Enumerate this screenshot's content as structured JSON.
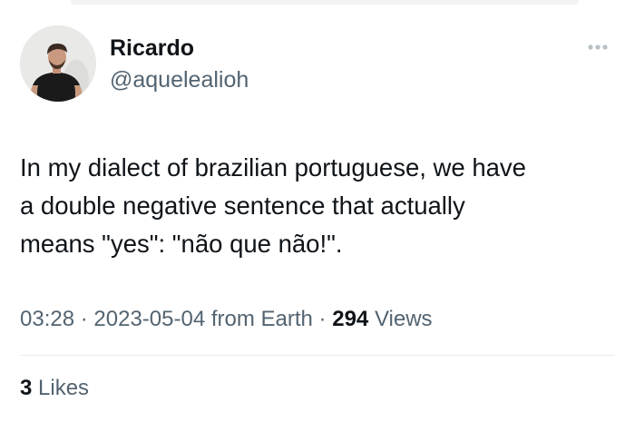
{
  "tweet": {
    "author_name": "Ricardo",
    "author_handle": "@aquelealioh",
    "text": "In my dialect of brazilian portuguese, we have\na double negative sentence that actually\nmeans \"yes\": \"não que não!\".",
    "time": "03:28",
    "separator": "·",
    "date": "2023-05-04",
    "source": "from Earth",
    "views_count": "294",
    "views_label": "Views",
    "likes_count": "3",
    "likes_label": "Likes"
  },
  "icons": {
    "more": "more-horizontal-icon",
    "avatar": "profile-photo"
  },
  "colors": {
    "text_primary": "#0f1419",
    "text_secondary": "#536471",
    "divider": "#e7e9ea",
    "more_icon": "#b9c0c6"
  }
}
